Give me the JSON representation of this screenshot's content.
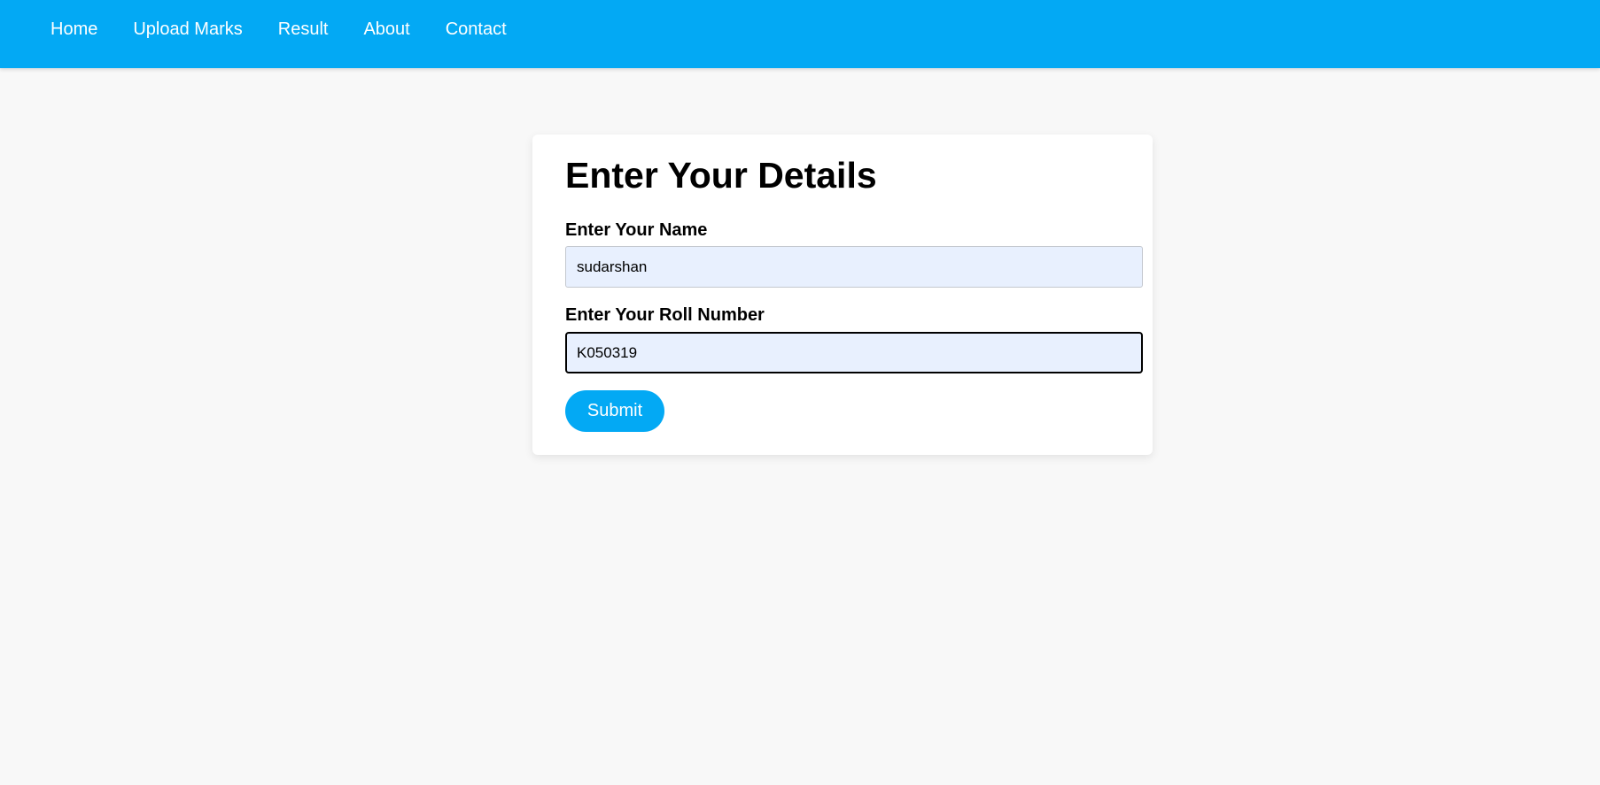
{
  "nav": {
    "items": [
      {
        "label": "Home"
      },
      {
        "label": "Upload Marks"
      },
      {
        "label": "Result"
      },
      {
        "label": "About"
      },
      {
        "label": "Contact"
      }
    ]
  },
  "form": {
    "title": "Enter Your Details",
    "name_label": "Enter Your Name",
    "name_value": "sudarshan",
    "roll_label": "Enter Your Roll Number",
    "roll_value": "K050319",
    "submit_label": "Submit"
  },
  "colors": {
    "primary": "#03a9f4",
    "page_background": "#f8f8f8",
    "input_background": "#e8f0fe",
    "card_background": "#ffffff"
  }
}
